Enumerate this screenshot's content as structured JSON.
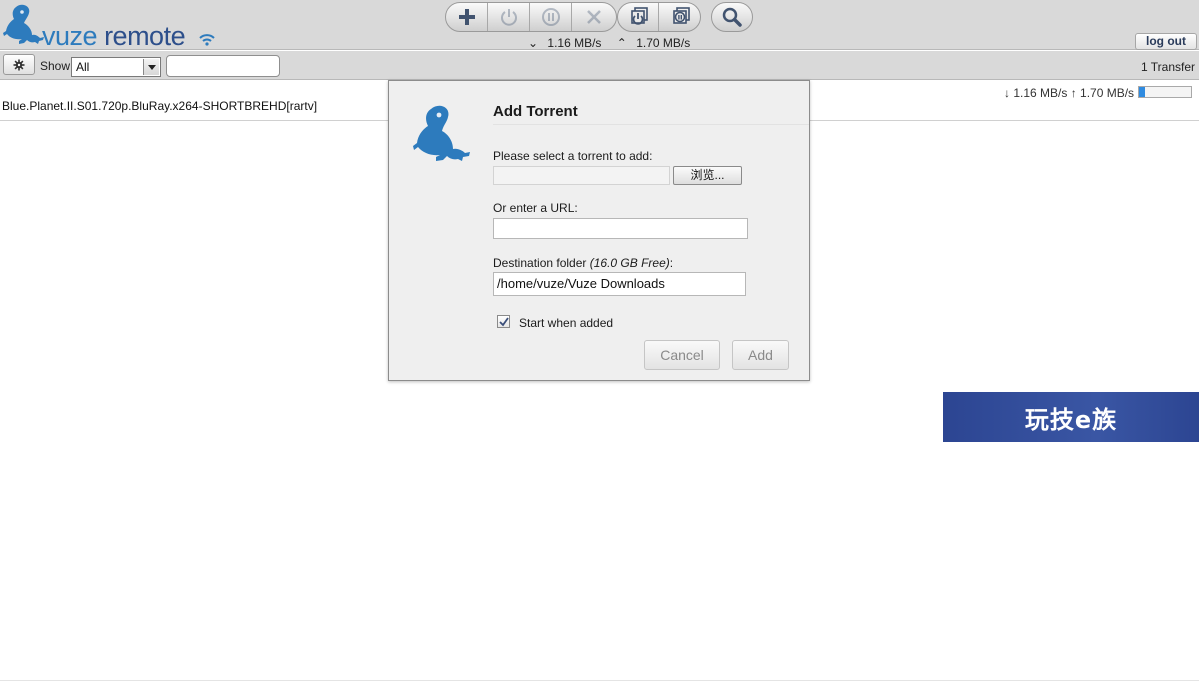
{
  "header": {
    "logo_part1": "vuze",
    "logo_part2": "remote",
    "toolbar": {
      "add_icon": "plus-icon",
      "start_icon": "power-icon",
      "pause_icon": "pause-icon",
      "remove_icon": "close-icon",
      "start_all_icon": "start-all-icon",
      "stop_all_icon": "stop-all-icon",
      "search_icon": "search-icon"
    },
    "download_rate": "1.16 MB/s",
    "upload_rate": "1.70 MB/s",
    "logout_label": "log out"
  },
  "filterbar": {
    "show_label": "Show",
    "show_selected": "All",
    "filter_value": "",
    "transfer_count": "1 Transfer"
  },
  "torrents": [
    {
      "name": "Blue.Planet.II.S01.720p.BluRay.x264-SHORTBREHD[rartv]",
      "speed": "↓ 1.16 MB/s ↑ 1.70 MB/s",
      "progress_fraction": 0.12
    }
  ],
  "dialog": {
    "title": "Add Torrent",
    "select_label": "Please select a torrent to add:",
    "browse_label": "浏览...",
    "url_label": "Or enter a URL:",
    "url_value": "",
    "dest_label": "Destination folder ",
    "dest_free": "(16.0 GB Free)",
    "dest_colon": ":",
    "dest_value": "/home/vuze/Vuze Downloads",
    "start_when_added_label": "Start when added",
    "start_when_added_checked": true,
    "cancel_label": "Cancel",
    "add_label": "Add"
  },
  "watermark": {
    "text": "玩技e族"
  },
  "colors": {
    "brand_blue": "#2d7bbd",
    "brand_dark": "#2d4f8b",
    "progress_fill": "#2f8be0",
    "watermark_bg": "#2c4592"
  }
}
